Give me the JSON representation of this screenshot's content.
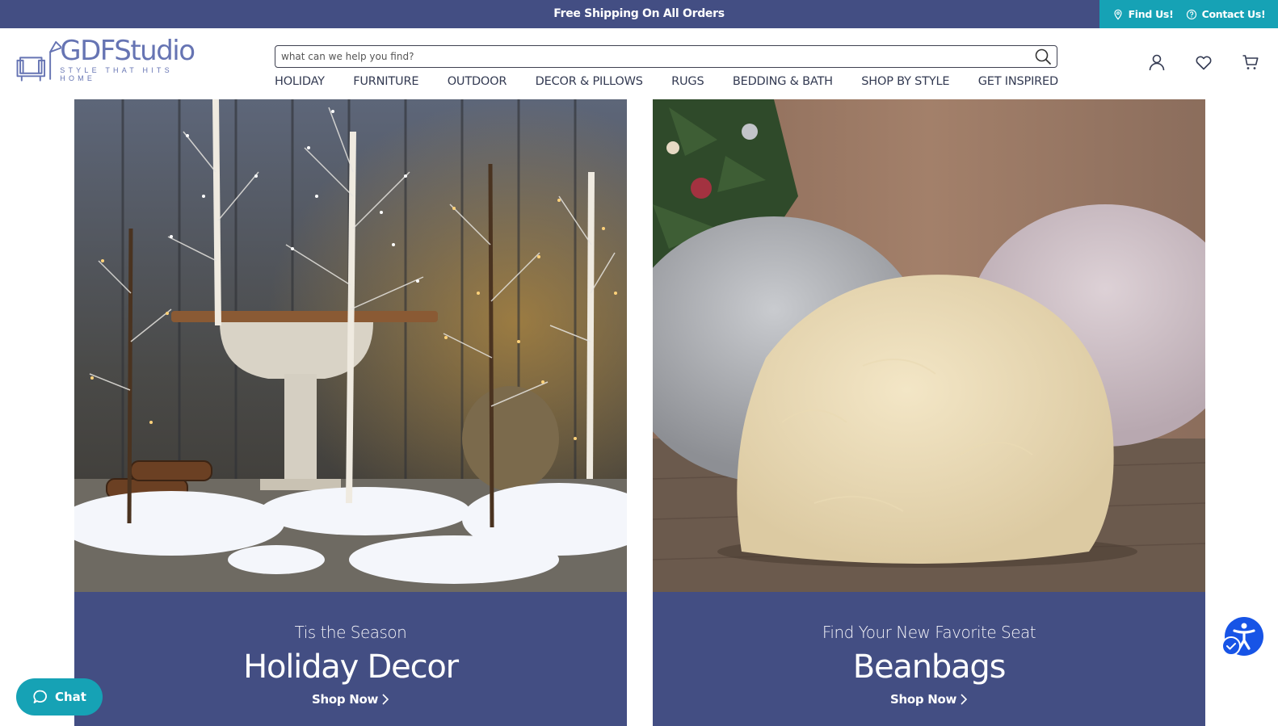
{
  "topbar": {
    "message": "Free Shipping On All Orders",
    "find_us": "Find Us!",
    "contact_us": "Contact Us!"
  },
  "logo": {
    "name": "GDFStudio",
    "tagline": "STYLE THAT HITS HOME"
  },
  "search": {
    "placeholder": "what can we help you find?",
    "value": ""
  },
  "nav": {
    "items": [
      {
        "label": "HOLIDAY"
      },
      {
        "label": "FURNITURE"
      },
      {
        "label": "OUTDOOR"
      },
      {
        "label": "DECOR & PILLOWS"
      },
      {
        "label": "RUGS"
      },
      {
        "label": "BEDDING & BATH"
      },
      {
        "label": "SHOP BY STYLE"
      },
      {
        "label": "GET INSPIRED"
      }
    ]
  },
  "header_icons": [
    "account-icon",
    "wishlist-heart-icon",
    "cart-icon"
  ],
  "cards": [
    {
      "subtitle": "Tis the Season",
      "title": "Holiday Decor",
      "cta": "Shop Now"
    },
    {
      "subtitle": "Find Your New Favorite Seat",
      "title": "Beanbags",
      "cta": "Shop Now"
    }
  ],
  "chat": {
    "label": "Chat"
  },
  "colors": {
    "brand_navy": "#434e83",
    "accent_teal": "#16a2b5",
    "accessibility_blue": "#1754e6",
    "logo_blue": "#6674b3"
  }
}
